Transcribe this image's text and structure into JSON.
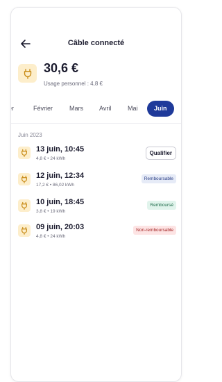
{
  "header": {
    "title": "Câble connecté"
  },
  "summary": {
    "amount": "30,6 €",
    "personal": "Usage personnel : 4,8 €"
  },
  "months": [
    {
      "label": "ier",
      "active": false
    },
    {
      "label": "Février",
      "active": false
    },
    {
      "label": "Mars",
      "active": false
    },
    {
      "label": "Avril",
      "active": false
    },
    {
      "label": "Mai",
      "active": false
    },
    {
      "label": "Juin",
      "active": true
    }
  ],
  "section": {
    "label": "Juin 2023"
  },
  "sessions": [
    {
      "date": "13 juin, 10:45",
      "meta": "4,8 € • 24 kWh",
      "action": "Qualifier"
    },
    {
      "date": "12 juin, 12:34",
      "meta": "17,2 € • 86,02 kWh",
      "status": "Remboursable"
    },
    {
      "date": "10 juin, 18:45",
      "meta": "3,8 € • 19 kWh",
      "status": "Remboursé"
    },
    {
      "date": "09 juin, 20:03",
      "meta": "4,8 € • 24 kWh",
      "status": "Non-remboursable"
    }
  ],
  "colors": {
    "accent": "#1f3a9a",
    "icon_bg": "#fdeecb",
    "icon_stroke": "#c88a14",
    "badge_refundable_bg": "#e6ebf7",
    "badge_refunded_bg": "#e1f4ec",
    "badge_nonrefundable_bg": "#fde4e4"
  },
  "icons": {
    "back": "arrow-left-icon",
    "plug": "plug-icon"
  }
}
